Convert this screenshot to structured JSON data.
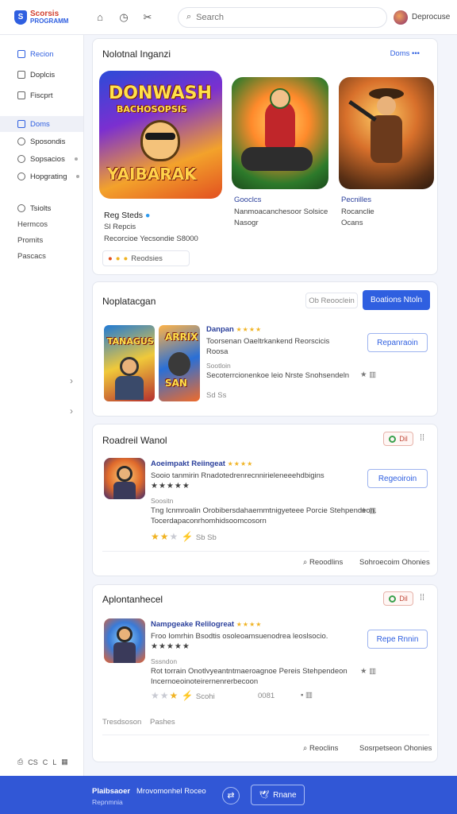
{
  "brand": {
    "line1": "Scorsis",
    "line2": "PROGRAMM"
  },
  "search": {
    "placeholder": "Search"
  },
  "user": {
    "name": "Deprocuse"
  },
  "sidebar": {
    "items": [
      {
        "label": "Recion"
      },
      {
        "label": "Doplcis"
      },
      {
        "label": "Fiscprt"
      },
      {
        "label": "Doms"
      },
      {
        "label": "Sposondis"
      },
      {
        "label": "Sopsacios"
      },
      {
        "label": "Hopgrating"
      },
      {
        "label": "Tsiolts"
      },
      {
        "label": "Hermcos"
      },
      {
        "label": "Promits"
      },
      {
        "label": "Pascacs"
      }
    ],
    "footer_labels": [
      "CS",
      "C",
      "L"
    ]
  },
  "featured": {
    "title": "Nolotnal Inganzi",
    "more_label": "Doms",
    "main_art_text1": "DONWASH",
    "main_art_text2": "BACHOSOPSIS",
    "main_art_text3": "YAIBARAK",
    "main_name": "Reg Steds",
    "main_sub": "Sl Repcis",
    "main_meta": "Recorcioe Yecsondie  S8000",
    "main_chip": "Reodsies",
    "card2_name": "Gooclcs",
    "card2_sub1": "Nanmoacanchesoor  Solsice",
    "card2_sub2": "Nasogr",
    "card3_name": "Pecnilles",
    "card3_sub1": "Rocanclie",
    "card3_sub2": "Ocans"
  },
  "section2": {
    "title": "Noplatacgan",
    "ghost_button": "Ob Reooclein",
    "primary_button": "Boations Ntoln",
    "art1_text": "TANAGUS",
    "art2_text": "ARRIX",
    "art2_text2": "SAN",
    "name": "Danpan",
    "desc1": "Toorsenan Oaeltrkankend Reorscicis",
    "desc2": "Roosa",
    "meta": "Sootloin",
    "desc3": "Secoterrcionenkoe leio Nrste Snohsendeln",
    "small_meta": "Sd  Ss",
    "button": "Repanraoin"
  },
  "section3": {
    "title": "Roadreil Wanol",
    "badge": "Dil",
    "name": "Aoeimpakt Reiingeat",
    "desc1": "Sooio tanmirin  Rnadotedrenrecnnirieleneeehdbigins",
    "meta": "Soositn",
    "desc2": "Tng Icnmroalin  Orobibersdahaemmtnigyeteee  Porcie  Stehpendeon.",
    "desc3": "Tocerdapaconrhomhidsoomcosorn",
    "rating_text": "Sb  Sb",
    "button": "Regeoiroin",
    "footer_link1": "Reoodlins",
    "footer_link2": "Sohroecoim  Ohonies"
  },
  "section4": {
    "title": "Aplontanhecel",
    "badge": "Dil",
    "name": "Nampgeake  Relilogreat",
    "desc1": "Froo Iomrhin  Bsodtis  osoleoamsuenodrea leoslsocio.",
    "meta": "Sssndon",
    "desc2": "Rot  torrain  Onotlvyeantntmaeroagnoe  Pereis  Stehpendeon",
    "desc3": "Incernoeoinoteirernenrerbecoon",
    "rating_text": "Scohi",
    "count": "0081",
    "button": "Repe Rnnin",
    "small1": "Tresdsoson",
    "small2": "Pashes",
    "footer_link1": "Reoclins",
    "footer_link2": "Sosrpetseon  Ohonies"
  },
  "footer": {
    "line1": "Plaibsaoer",
    "line1b": "Mrovomonhel  Roceo",
    "line2": "Repnmnia",
    "button": "Rnane"
  },
  "colors": {
    "accent": "#2f5fe0",
    "footer": "#3157d6",
    "star": "#f0b323"
  }
}
